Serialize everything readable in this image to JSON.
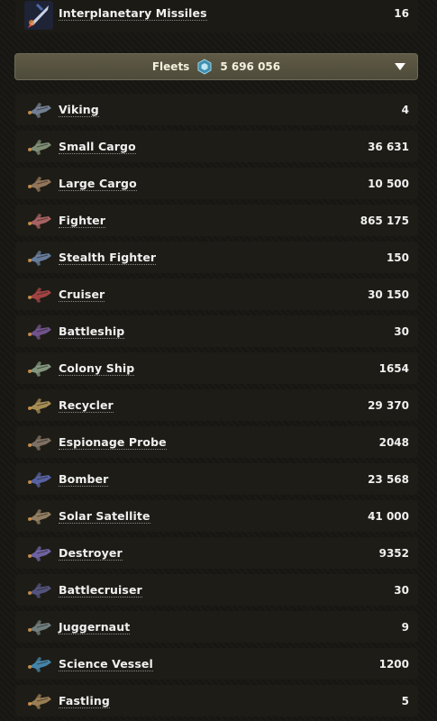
{
  "defense_top": {
    "name": "Interplanetary Missiles",
    "count": "16",
    "icon": "missile-icon"
  },
  "fleet_header": {
    "label": "Fleets",
    "total": "5 696 056",
    "icon": "deuterium-resource-icon",
    "toggle_icon": "chevron-down-icon"
  },
  "ships": [
    {
      "name": "Viking",
      "count": "4",
      "icon": "viking-icon",
      "color": "#7c8aa0"
    },
    {
      "name": "Small Cargo",
      "count": "36 631",
      "icon": "small-cargo-icon",
      "color": "#8a9a7e"
    },
    {
      "name": "Large Cargo",
      "count": "10 500",
      "icon": "large-cargo-icon",
      "color": "#a08060"
    },
    {
      "name": "Fighter",
      "count": "865 175",
      "icon": "fighter-icon",
      "color": "#b86a6a"
    },
    {
      "name": "Stealth Fighter",
      "count": "150",
      "icon": "stealth-fighter-icon",
      "color": "#6f86a8"
    },
    {
      "name": "Cruiser",
      "count": "30 150",
      "icon": "cruiser-icon",
      "color": "#b04848"
    },
    {
      "name": "Battleship",
      "count": "30",
      "icon": "battleship-icon",
      "color": "#7a5a98"
    },
    {
      "name": "Colony Ship",
      "count": "1654",
      "icon": "colony-ship-icon",
      "color": "#8ea488"
    },
    {
      "name": "Recycler",
      "count": "29 370",
      "icon": "recycler-icon",
      "color": "#b59a5a"
    },
    {
      "name": "Espionage Probe",
      "count": "2048",
      "icon": "espionage-probe-icon",
      "color": "#8a7a6a"
    },
    {
      "name": "Bomber",
      "count": "23 568",
      "icon": "bomber-icon",
      "color": "#5e6ab0"
    },
    {
      "name": "Solar Satellite",
      "count": "41 000",
      "icon": "solar-satellite-icon",
      "color": "#a08a6a"
    },
    {
      "name": "Destroyer",
      "count": "9352",
      "icon": "destroyer-icon",
      "color": "#7a6ab0"
    },
    {
      "name": "Battlecruiser",
      "count": "30",
      "icon": "battlecruiser-icon",
      "color": "#5a5a88"
    },
    {
      "name": "Juggernaut",
      "count": "9",
      "icon": "juggernaut-icon",
      "color": "#7a8888"
    },
    {
      "name": "Science Vessel",
      "count": "1200",
      "icon": "science-vessel-icon",
      "color": "#4a90b8"
    },
    {
      "name": "Fastling",
      "count": "5",
      "icon": "fastling-icon",
      "color": "#a88a5a"
    }
  ]
}
